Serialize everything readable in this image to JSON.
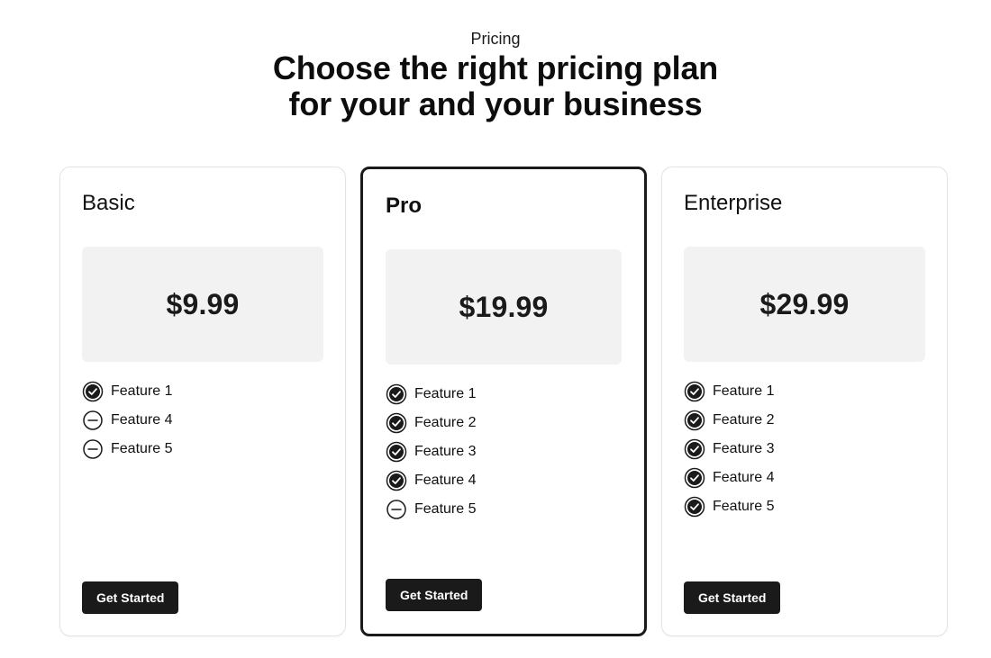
{
  "header": {
    "eyebrow": "Pricing",
    "title_line1": "Choose the right pricing plan",
    "title_line2": "for your and your business"
  },
  "plans": [
    {
      "name": "Basic",
      "price": "$9.99",
      "featured": false,
      "cta_label": "Get Started",
      "features": [
        {
          "label": "Feature 1",
          "status": "included",
          "icon": "check-circle-icon"
        },
        {
          "label": "Feature 4",
          "status": "excluded",
          "icon": "minus-circle-icon"
        },
        {
          "label": "Feature 5",
          "status": "excluded",
          "icon": "minus-circle-icon"
        }
      ]
    },
    {
      "name": "Pro",
      "price": "$19.99",
      "featured": true,
      "cta_label": "Get Started",
      "features": [
        {
          "label": "Feature 1",
          "status": "included",
          "icon": "check-circle-icon"
        },
        {
          "label": "Feature 2",
          "status": "included",
          "icon": "check-circle-icon"
        },
        {
          "label": "Feature 3",
          "status": "included",
          "icon": "check-circle-icon"
        },
        {
          "label": "Feature 4",
          "status": "included",
          "icon": "check-circle-icon"
        },
        {
          "label": "Feature 5",
          "status": "excluded",
          "icon": "minus-circle-icon"
        }
      ]
    },
    {
      "name": "Enterprise",
      "price": "$29.99",
      "featured": false,
      "cta_label": "Get Started",
      "features": [
        {
          "label": "Feature 1",
          "status": "included",
          "icon": "check-circle-icon"
        },
        {
          "label": "Feature 2",
          "status": "included",
          "icon": "check-circle-icon"
        },
        {
          "label": "Feature 3",
          "status": "included",
          "icon": "check-circle-icon"
        },
        {
          "label": "Feature 4",
          "status": "included",
          "icon": "check-circle-icon"
        },
        {
          "label": "Feature 5",
          "status": "included",
          "icon": "check-circle-icon"
        }
      ]
    }
  ],
  "colors": {
    "accent": "#1a1a1a",
    "price_box_bg": "#f2f2f2",
    "card_border": "#e3e3e3"
  }
}
